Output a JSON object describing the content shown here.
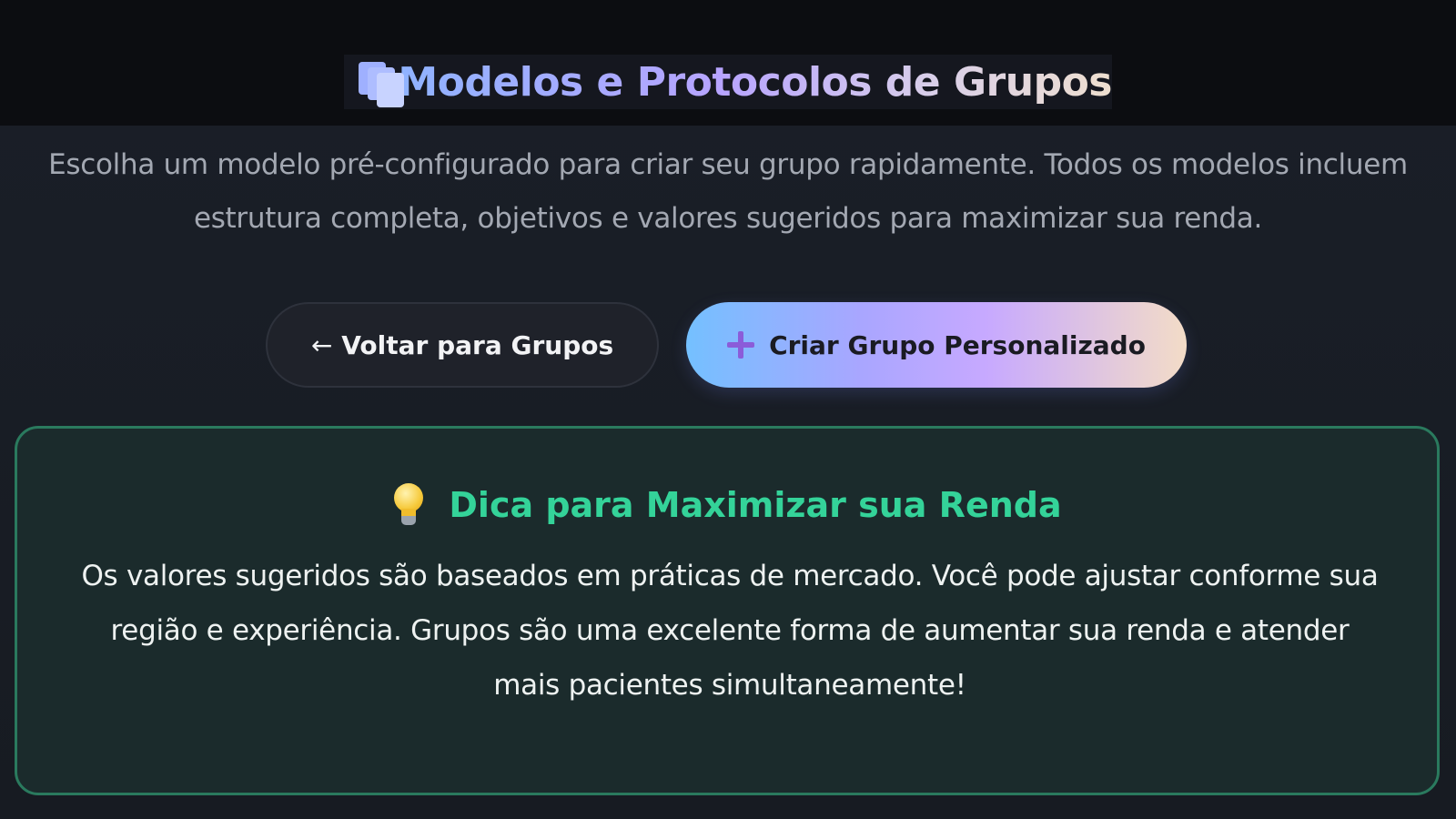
{
  "header": {
    "title": "Modelos e Protocolos de Grupos",
    "icon": "card-index-dividers-icon"
  },
  "subtitle": "Escolha um modelo pré-configurado para criar seu grupo rapidamente. Todos os modelos incluem estrutura completa, objetivos e valores sugeridos para maximizar sua renda.",
  "actions": {
    "back": {
      "arrow": "←",
      "label": "Voltar para Grupos"
    },
    "create": {
      "icon": "plus-icon",
      "label": "Criar Grupo Personalizado"
    }
  },
  "tip": {
    "icon": "lightbulb-icon",
    "title": "Dica para Maximizar sua Renda",
    "body": "Os valores sugeridos são baseados em práticas de mercado. Você pode ajustar conforme sua região e experiência. Grupos são uma excelente forma de aumentar sua renda e atender mais pacientes simultaneamente!"
  },
  "colors": {
    "background": "#181c24",
    "header_band": "#0c0d11",
    "accent_green": "#34d399",
    "tip_border": "#2a7a5e",
    "tip_background": "#1b2b2c",
    "plus_purple": "#8b5cd9"
  }
}
